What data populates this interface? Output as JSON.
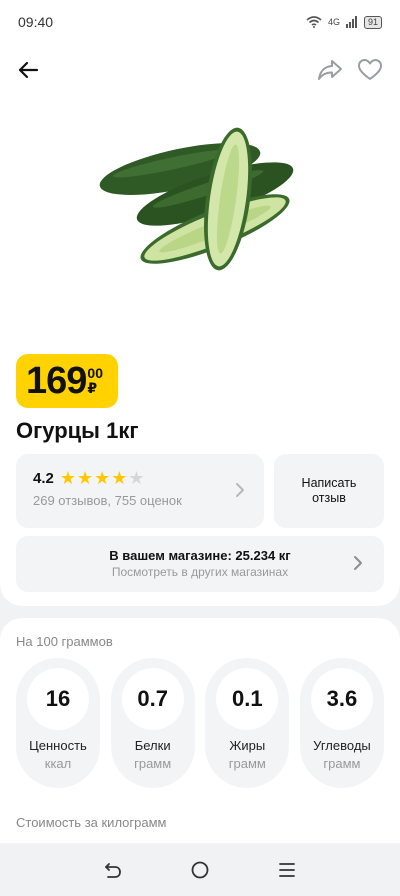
{
  "status_bar": {
    "time": "09:40",
    "network": "4G",
    "battery": "91"
  },
  "nav": {
    "back_icon": "arrow-left-icon",
    "share_icon": "share-icon",
    "favorite_icon": "heart-icon"
  },
  "product": {
    "image": "cucumber-photo",
    "price_rub": "169",
    "price_kop": "00",
    "currency": "₽",
    "title": "Огурцы 1кг",
    "rating": {
      "value": "4.2",
      "stars": 4,
      "max_stars": 5,
      "summary": "269 отзывов, 755 оценок"
    },
    "write_review_label": "Написать отзыв",
    "store": {
      "title": "В вашем магазине: 25.234 кг",
      "subtitle": "Посмотреть в других магазинах"
    }
  },
  "nutrition": {
    "heading": "На 100 граммов",
    "items": [
      {
        "value": "16",
        "label": "Ценность",
        "unit": "ккал"
      },
      {
        "value": "0.7",
        "label": "Белки",
        "unit": "грамм"
      },
      {
        "value": "0.1",
        "label": "Жиры",
        "unit": "грамм"
      },
      {
        "value": "3.6",
        "label": "Углеводы",
        "unit": "грамм"
      }
    ],
    "cost_heading": "Стоимость за килограмм"
  },
  "colors": {
    "accent_yellow": "#ffd200",
    "star": "#ffc800",
    "card_bg": "#f3f4f6"
  }
}
